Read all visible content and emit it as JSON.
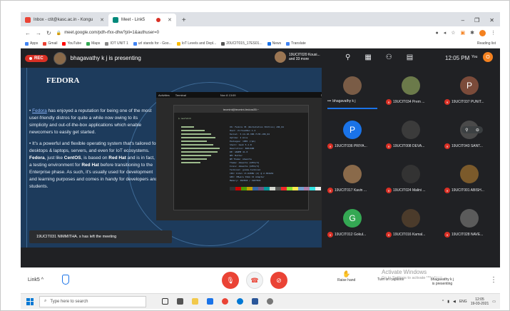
{
  "browser": {
    "tabs": [
      {
        "label": "Inbox - ctit@kasc.ac.in - Kongu",
        "color": "#ea4335"
      },
      {
        "label": "Meet - Link5",
        "color": "#00897b"
      }
    ],
    "url": "meet.google.com/pdh-rfxx-dhw?pli=1&authuser=0",
    "bookmarks": [
      {
        "label": "Apps",
        "color": "#4285f4"
      },
      {
        "label": "Gmail",
        "color": "#ea4335"
      },
      {
        "label": "YouTube",
        "color": "#ff0000"
      },
      {
        "label": "Maps",
        "color": "#34a853"
      },
      {
        "label": "IOT UNIT 1",
        "color": "#888888"
      },
      {
        "label": "url stands for - Goo...",
        "color": "#4285f4"
      },
      {
        "label": "IoT Levels and Depl...",
        "color": "#fbbc05"
      },
      {
        "label": "20UCIT015_17ES01...",
        "color": "#555555"
      },
      {
        "label": "News",
        "color": "#1a73e8"
      },
      {
        "label": "Translate",
        "color": "#4285f4"
      }
    ],
    "reading_list": "Reading list"
  },
  "meet": {
    "rec": "REC",
    "presenting": "bhagavathy k j is presenting",
    "top_group_line1": "19UCIT020 Kousi...",
    "top_group_line2": "and 33 more",
    "time": "12:05 PM",
    "you": "You",
    "you_initial": "O",
    "notice": "19UCIT031 NIMMITHA. s has left the meeting",
    "meeting_code": "Link5",
    "caret": "^",
    "raise_hand": "Raise hand",
    "captions": "Turn on captions",
    "presenter_line1": "bhagavathy k j",
    "presenter_line2": "is presenting",
    "activate_line1": "Activate Windows",
    "activate_line2": "Go to Settings to activate Windows."
  },
  "slide": {
    "title": "FEDORA",
    "p1_link": "Fedora",
    "p1_rest": " has enjoyed a reputation for being one of the most user-friendly distros for quite a while now owing to its simplicity and out-of-the-box applications which enable newcomers to easily get started.",
    "p2_a": "It's a powerful and flexible operating system that's tailored for desktops & laptops, servers, and even for IoT ecosystems. ",
    "p2_b": "Fedora",
    "p2_c": ", just like ",
    "p2_d": "CentOS",
    "p2_e": ", is based on ",
    "p2_f": "Red Hat",
    "p2_g": " and is in fact, a testing environment for ",
    "p2_h": "Red Hat",
    "p2_i": " before transitioning to the Enterprise phase. As such, it's usually used for development and learning purposes and comes in handy for developers and students.",
    "desk_activities": "Activities",
    "desk_terminal": "Terminal",
    "desk_time": "Nov 8 13:09",
    "term_title": "tecmint@tecmint-fedora35:~",
    "term_prompt": "neofetch",
    "info_lines": [
      "OS: Fedora 35 (Workstation Edition) x86_64",
      "Host: VirtualBox 1.2",
      "Kernel: 5.14.10-300.fc35.x86_64",
      "Uptime: 2 mins",
      "Packages: 1885 (rpm)",
      "Shell: bash 5.1.8",
      "Resolution: 800x600",
      "DE: GNOME 41.0",
      "WM: Mutter",
      "WM Theme: Adwaita",
      "Theme: Adwaita [GTK2/3]",
      "Icons: Adwaita [GTK2/3]",
      "Terminal: gnome-terminal",
      "CPU: Intel i5-6200U (2) @ 2.304GHz",
      "GPU: VMware SVGA II Adapter",
      "Memory: 382MiB / 1987MiB"
    ],
    "palette": [
      "#2e3436",
      "#cc0000",
      "#4e9a06",
      "#c4a000",
      "#3465a4",
      "#75507b",
      "#06989a",
      "#d3d7cf",
      "#555753",
      "#ef2929",
      "#8ae234",
      "#fce94f",
      "#729fcf",
      "#ad7fa8",
      "#34e2e2",
      "#eeeeec"
    ]
  },
  "participants": [
    {
      "name": "bhagavathy k j",
      "muted": false,
      "initial": "",
      "color": "#7a5c46"
    },
    {
      "name": "19UCIT034 Prem ...",
      "muted": true,
      "initial": "",
      "color": "#6b7a4a"
    },
    {
      "name": "19UCIT037 PUNIT...",
      "muted": true,
      "initial": "P",
      "color": "#7b4b3a"
    },
    {
      "name": "19UCIT036 PRIYA...",
      "muted": true,
      "initial": "P",
      "color": "#1a73e8"
    },
    {
      "name": "19UCIT008 DEVA...",
      "muted": true,
      "initial": "",
      "color": "#3b3b3b"
    },
    {
      "name": "19UCIT043 SANT...",
      "muted": true,
      "initial": "",
      "color": "#4a4a4a"
    },
    {
      "name": "19UCIT017 Kavin ...",
      "muted": true,
      "initial": "",
      "color": "#8a6a4a"
    },
    {
      "name": "19UCIT024 Malini ...",
      "muted": true,
      "initial": "",
      "color": "#333333"
    },
    {
      "name": "19UCIT001 ABISH...",
      "muted": true,
      "initial": "",
      "color": "#7b5a2b"
    },
    {
      "name": "19UCIT012 Gokul...",
      "muted": true,
      "initial": "G",
      "color": "#34a853"
    },
    {
      "name": "19UCIT016 Kamal...",
      "muted": true,
      "initial": "",
      "color": "#4b3b2b"
    },
    {
      "name": "19UCIT028 NAVE...",
      "muted": true,
      "initial": "",
      "color": "#5b5b5b"
    }
  ],
  "taskbar": {
    "search_placeholder": "Type here to search",
    "lang": "ENG",
    "time": "12:05",
    "date": "19-03-2021"
  }
}
